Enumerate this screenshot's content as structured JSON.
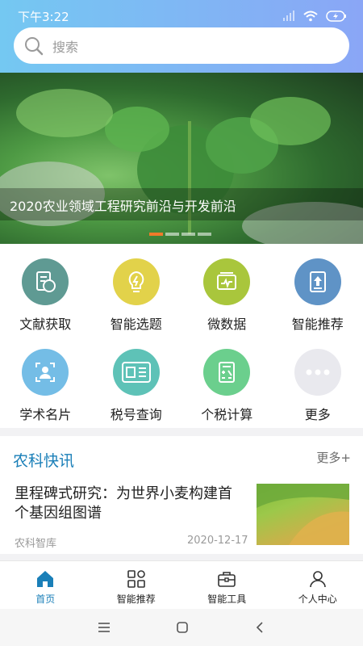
{
  "status": {
    "time": "下午3:22"
  },
  "search": {
    "placeholder": "搜索"
  },
  "banner": {
    "caption": "2020农业领域工程研究前沿与开发前沿"
  },
  "features": [
    {
      "label": "文献获取",
      "icon": "document-icon",
      "color": "#5f9a93"
    },
    {
      "label": "智能选题",
      "icon": "lightbulb-icon",
      "color": "#e2d24a"
    },
    {
      "label": "微数据",
      "icon": "data-icon",
      "color": "#a9c63c"
    },
    {
      "label": "智能推荐",
      "icon": "recommend-icon",
      "color": "#5f93c6"
    },
    {
      "label": "学术名片",
      "icon": "scholar-card-icon",
      "color": "#74bde6"
    },
    {
      "label": "税号查询",
      "icon": "tax-icon",
      "color": "#5ec2b7"
    },
    {
      "label": "个税计算",
      "icon": "calculator-icon",
      "color": "#6bcf8d"
    },
    {
      "label": "更多",
      "icon": "more-icon",
      "color": "#e9e9ee"
    }
  ],
  "news": {
    "section_title": "农科快讯",
    "more": "更多+",
    "title": "里程碑式研究：为世界小麦构建首个基因组图谱",
    "source": "农科智库",
    "date": "2020-12-17"
  },
  "tabs": [
    {
      "label": "首页",
      "icon": "home-icon"
    },
    {
      "label": "智能推荐",
      "icon": "grid-icon"
    },
    {
      "label": "智能工具",
      "icon": "toolbox-icon"
    },
    {
      "label": "个人中心",
      "icon": "user-icon"
    }
  ]
}
